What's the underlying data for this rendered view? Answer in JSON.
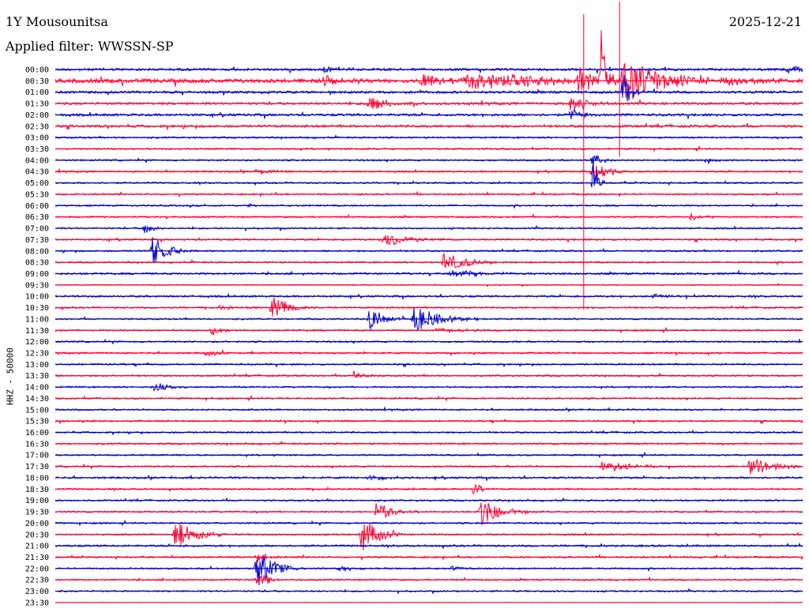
{
  "header": {
    "station": "1Y Mousounitsa",
    "date": "2025-12-21",
    "filter": "Applied filter: WWSSN-SP",
    "channel_label": "HHZ - 50000"
  },
  "chart_data": {
    "type": "line",
    "title": "1Y Mousounitsa",
    "subtitle": "Applied filter: WWSSN-SP",
    "ylabel": "HHZ - 50000",
    "date": "2025-12-21",
    "colors": [
      "#0000cc",
      "#ff0033"
    ],
    "traces": [
      {
        "time": "00:00",
        "color": "#0000cc",
        "noise": 1.5,
        "events": [
          {
            "x": 0.36,
            "amp": 4,
            "dur": 0.04
          },
          {
            "x": 0.98,
            "amp": 6,
            "dur": 0.02
          }
        ]
      },
      {
        "time": "00:30",
        "color": "#ff0033",
        "noise": 2.5,
        "events": [
          {
            "x": 0.36,
            "amp": 8,
            "dur": 0.02
          },
          {
            "x": 0.49,
            "amp": 8,
            "dur": 0.04
          },
          {
            "x": 0.55,
            "amp": 12,
            "dur": 0.1
          },
          {
            "x": 0.7,
            "amp": 16,
            "dur": 0.03
          },
          {
            "x": 0.73,
            "amp": 80,
            "dur": 0.005
          },
          {
            "x": 0.76,
            "amp": 30,
            "dur": 0.05
          },
          {
            "x": 0.9,
            "amp": 6,
            "dur": 0.04
          }
        ]
      },
      {
        "time": "01:00",
        "color": "#0000cc",
        "noise": 1.5,
        "events": [
          {
            "x": 0.76,
            "amp": 30,
            "dur": 0.01
          }
        ]
      },
      {
        "time": "01:30",
        "color": "#ff0033",
        "noise": 1.5,
        "events": [
          {
            "x": 0.42,
            "amp": 10,
            "dur": 0.025
          },
          {
            "x": 0.69,
            "amp": 12,
            "dur": 0.02
          }
        ]
      },
      {
        "time": "02:00",
        "color": "#0000cc",
        "noise": 1.5,
        "events": [
          {
            "x": 0.69,
            "amp": 8,
            "dur": 0.015
          }
        ]
      },
      {
        "time": "02:30",
        "color": "#ff0033",
        "noise": 1.5,
        "events": []
      },
      {
        "time": "03:00",
        "color": "#0000cc",
        "noise": 1.0,
        "events": []
      },
      {
        "time": "03:30",
        "color": "#ff0033",
        "noise": 1.0,
        "events": []
      },
      {
        "time": "04:00",
        "color": "#0000cc",
        "noise": 1.0,
        "events": [
          {
            "x": 0.72,
            "amp": 10,
            "dur": 0.01
          },
          {
            "x": 0.87,
            "amp": 4,
            "dur": 0.01
          }
        ]
      },
      {
        "time": "04:30",
        "color": "#ff0033",
        "noise": 1.0,
        "events": [
          {
            "x": 0.27,
            "amp": 4,
            "dur": 0.02
          },
          {
            "x": 0.72,
            "amp": 20,
            "dur": 0.015
          }
        ]
      },
      {
        "time": "05:00",
        "color": "#0000cc",
        "noise": 1.0,
        "events": [
          {
            "x": 0.72,
            "amp": 40,
            "dur": 0.005
          }
        ]
      },
      {
        "time": "05:30",
        "color": "#ff0033",
        "noise": 1.0,
        "events": []
      },
      {
        "time": "06:00",
        "color": "#0000cc",
        "noise": 1.0,
        "events": [
          {
            "x": 0.26,
            "amp": 3,
            "dur": 0.01
          }
        ]
      },
      {
        "time": "06:30",
        "color": "#ff0033",
        "noise": 1.0,
        "events": [
          {
            "x": 0.85,
            "amp": 4,
            "dur": 0.02
          }
        ]
      },
      {
        "time": "07:00",
        "color": "#0000cc",
        "noise": 1.0,
        "events": [
          {
            "x": 0.12,
            "amp": 8,
            "dur": 0.01
          }
        ]
      },
      {
        "time": "07:30",
        "color": "#ff0033",
        "noise": 1.0,
        "events": [
          {
            "x": 0.44,
            "amp": 10,
            "dur": 0.03
          }
        ]
      },
      {
        "time": "08:00",
        "color": "#0000cc",
        "noise": 1.0,
        "events": [
          {
            "x": 0.13,
            "amp": 18,
            "dur": 0.02
          }
        ]
      },
      {
        "time": "08:30",
        "color": "#ff0033",
        "noise": 1.0,
        "events": [
          {
            "x": 0.52,
            "amp": 12,
            "dur": 0.03
          }
        ]
      },
      {
        "time": "09:00",
        "color": "#0000cc",
        "noise": 1.2,
        "events": [
          {
            "x": 0.53,
            "amp": 4,
            "dur": 0.05
          }
        ]
      },
      {
        "time": "09:30",
        "color": "#ff0033",
        "noise": 0.6,
        "events": []
      },
      {
        "time": "10:00",
        "color": "#0000cc",
        "noise": 1.2,
        "events": [
          {
            "x": 0.8,
            "amp": 3,
            "dur": 0.02
          }
        ]
      },
      {
        "time": "10:30",
        "color": "#ff0033",
        "noise": 1.0,
        "events": [
          {
            "x": 0.22,
            "amp": 4,
            "dur": 0.02
          },
          {
            "x": 0.29,
            "amp": 16,
            "dur": 0.02
          }
        ]
      },
      {
        "time": "11:00",
        "color": "#0000cc",
        "noise": 1.0,
        "events": [
          {
            "x": 0.42,
            "amp": 14,
            "dur": 0.02
          },
          {
            "x": 0.48,
            "amp": 18,
            "dur": 0.03
          }
        ]
      },
      {
        "time": "11:30",
        "color": "#ff0033",
        "noise": 1.0,
        "events": [
          {
            "x": 0.21,
            "amp": 8,
            "dur": 0.01
          },
          {
            "x": 0.51,
            "amp": 3,
            "dur": 0.04
          }
        ]
      },
      {
        "time": "12:00",
        "color": "#0000cc",
        "noise": 1.0,
        "events": []
      },
      {
        "time": "12:30",
        "color": "#ff0033",
        "noise": 1.0,
        "events": [
          {
            "x": 0.2,
            "amp": 4,
            "dur": 0.02
          }
        ]
      },
      {
        "time": "13:00",
        "color": "#0000cc",
        "noise": 1.0,
        "events": []
      },
      {
        "time": "13:30",
        "color": "#ff0033",
        "noise": 1.0,
        "events": [
          {
            "x": 0.4,
            "amp": 8,
            "dur": 0.01
          }
        ]
      },
      {
        "time": "14:00",
        "color": "#0000cc",
        "noise": 1.0,
        "events": [
          {
            "x": 0.13,
            "amp": 6,
            "dur": 0.02
          }
        ]
      },
      {
        "time": "14:30",
        "color": "#ff0033",
        "noise": 1.0,
        "events": []
      },
      {
        "time": "15:00",
        "color": "#0000cc",
        "noise": 1.0,
        "events": []
      },
      {
        "time": "15:30",
        "color": "#ff0033",
        "noise": 1.0,
        "events": []
      },
      {
        "time": "16:00",
        "color": "#0000cc",
        "noise": 1.0,
        "events": []
      },
      {
        "time": "16:30",
        "color": "#ff0033",
        "noise": 1.0,
        "events": []
      },
      {
        "time": "17:00",
        "color": "#0000cc",
        "noise": 1.0,
        "events": []
      },
      {
        "time": "17:30",
        "color": "#ff0033",
        "noise": 1.0,
        "events": [
          {
            "x": 0.73,
            "amp": 10,
            "dur": 0.03
          },
          {
            "x": 0.93,
            "amp": 12,
            "dur": 0.03
          }
        ]
      },
      {
        "time": "18:00",
        "color": "#0000cc",
        "noise": 1.2,
        "events": [
          {
            "x": 0.42,
            "amp": 3,
            "dur": 0.03
          }
        ]
      },
      {
        "time": "18:30",
        "color": "#ff0033",
        "noise": 1.0,
        "events": [
          {
            "x": 0.56,
            "amp": 10,
            "dur": 0.01
          }
        ]
      },
      {
        "time": "19:00",
        "color": "#0000cc",
        "noise": 1.0,
        "events": []
      },
      {
        "time": "19:30",
        "color": "#ff0033",
        "noise": 1.0,
        "events": [
          {
            "x": 0.43,
            "amp": 14,
            "dur": 0.02
          },
          {
            "x": 0.57,
            "amp": 18,
            "dur": 0.025
          }
        ]
      },
      {
        "time": "20:00",
        "color": "#0000cc",
        "noise": 1.0,
        "events": []
      },
      {
        "time": "20:30",
        "color": "#ff0033",
        "noise": 1.0,
        "events": [
          {
            "x": 0.16,
            "amp": 20,
            "dur": 0.025
          },
          {
            "x": 0.41,
            "amp": 24,
            "dur": 0.02
          }
        ]
      },
      {
        "time": "21:00",
        "color": "#0000cc",
        "noise": 1.2,
        "events": []
      },
      {
        "time": "21:30",
        "color": "#ff0033",
        "noise": 1.0,
        "events": [
          {
            "x": 0.27,
            "amp": 10,
            "dur": 0.01
          }
        ]
      },
      {
        "time": "22:00",
        "color": "#0000cc",
        "noise": 1.0,
        "events": [
          {
            "x": 0.27,
            "amp": 26,
            "dur": 0.02
          },
          {
            "x": 0.38,
            "amp": 4,
            "dur": 0.02
          },
          {
            "x": 0.53,
            "amp": 4,
            "dur": 0.01
          }
        ]
      },
      {
        "time": "22:30",
        "color": "#ff0033",
        "noise": 1.0,
        "events": [
          {
            "x": 0.27,
            "amp": 10,
            "dur": 0.015
          }
        ]
      },
      {
        "time": "23:00",
        "color": "#0000cc",
        "noise": 1.0,
        "events": []
      },
      {
        "time": "23:30",
        "color": "#ff0033",
        "noise": 0.2,
        "events": []
      }
    ]
  }
}
